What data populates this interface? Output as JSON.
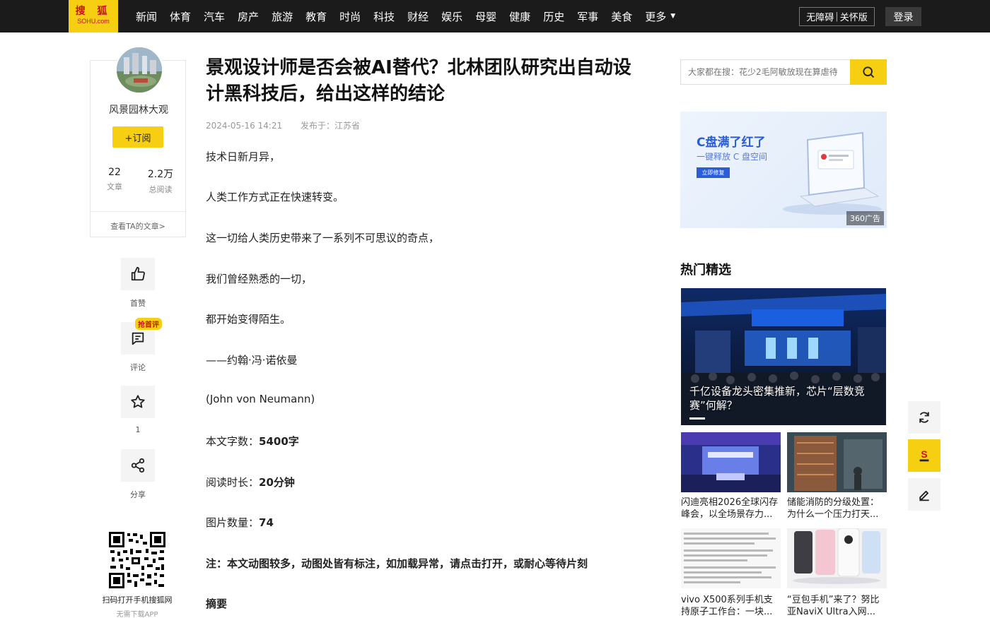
{
  "header": {
    "logo_top": "搜 狐",
    "logo_bottom": "SOHU.com",
    "nav": [
      "新闻",
      "体育",
      "汽车",
      "房产",
      "旅游",
      "教育",
      "时尚",
      "科技",
      "财经",
      "娱乐",
      "母婴",
      "健康",
      "历史",
      "军事",
      "美食"
    ],
    "more_label": "更多",
    "access_a": "无障碍",
    "access_sep": "|",
    "access_b": "关怀版",
    "login_label": "登录"
  },
  "author": {
    "name": "风景园林大观",
    "subscribe_label": "+订阅",
    "articles_count": "22",
    "articles_label": "文章",
    "reads_count": "2.2万",
    "reads_label": "总阅读",
    "view_link": "查看TA的文章>"
  },
  "actions": {
    "like_label": "首赞",
    "comment_badge": "抢首评",
    "comment_label": "评论",
    "fav_count": "1",
    "share_label": "分享"
  },
  "qr": {
    "text": "扫码打开手机搜狐网",
    "sub": "无需下载APP"
  },
  "article": {
    "title": "景观设计师是否会被AI替代？北林团队研究出自动设计黑科技后，给出这样的结论",
    "date": "2024-05-16 14:21",
    "published_in": "发布于：江苏省",
    "p1": "技术日新月异，",
    "p2": "人类工作方式正在快速转变。",
    "p3": "这一切给人类历史带来了一系列不可思议的奇点，",
    "p4": "我们曾经熟悉的一切，",
    "p5": "都开始变得陌生。",
    "p6": "——约翰·冯·诺依曼",
    "p7": "(John von Neumann)",
    "wordcount_label": "本文字数：",
    "wordcount_value": "5400字",
    "readtime_label": "阅读时长：",
    "readtime_value": "20分钟",
    "images_label": "图片数量：",
    "images_value": "74",
    "note": "注：本文动图较多，动图处皆有标注，如加载异常，请点击打开，或耐心等待片刻",
    "summary_heading": "摘要"
  },
  "search": {
    "placeholder": "大家都在搜：花少2毛阿敏放现在算虐待"
  },
  "ad": {
    "title": "C盘满了红了",
    "subtitle": "一键释放 C 盘空间",
    "button": "立即修复",
    "tag": "360广告"
  },
  "hot": {
    "heading": "热门精选",
    "main_caption": "千亿设备龙头密集推新，芯片“层数竞赛”何解？",
    "items": [
      {
        "caption": "闪迪亮相2026全球闪存峰会，以全场景存力..."
      },
      {
        "caption": "储能消防的分级处置：为什么一个压力打天..."
      },
      {
        "caption": "vivo X500系列手机支持原子工作台：一块..."
      },
      {
        "caption": "“豆包手机”来了？努比亚NaviX Ultra入网..."
      }
    ]
  },
  "colors": {
    "brand_yellow": "#f6ce12",
    "topbar": "#1b1b1b",
    "logo_red": "#c8101f"
  }
}
